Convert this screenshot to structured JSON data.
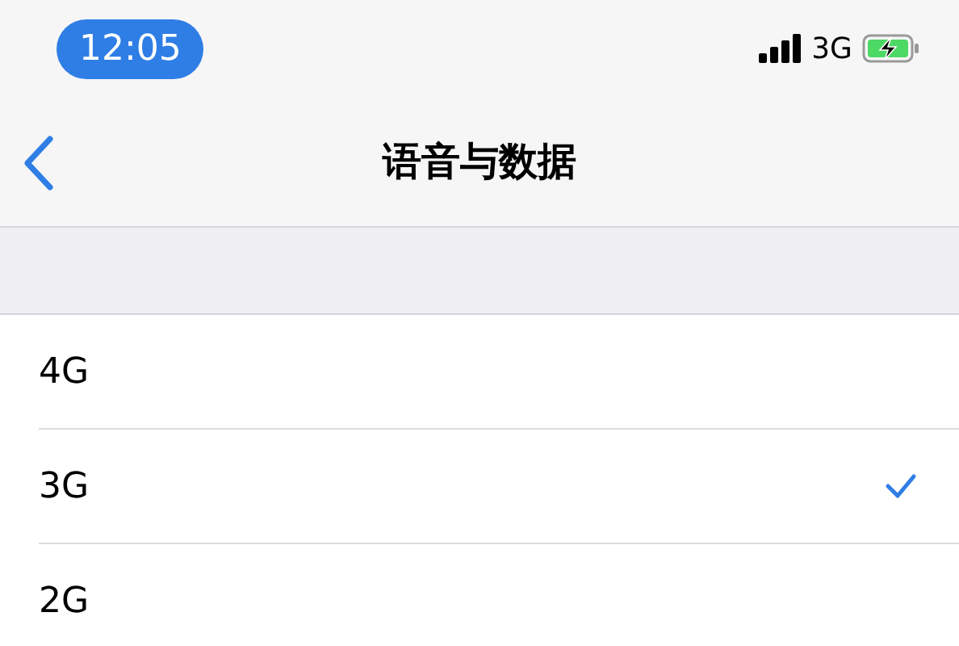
{
  "status_bar": {
    "time": "12:05",
    "network": "3G"
  },
  "nav": {
    "title": "语音与数据"
  },
  "options": [
    {
      "label": "4G",
      "selected": false
    },
    {
      "label": "3G",
      "selected": true
    },
    {
      "label": "2G",
      "selected": false
    }
  ]
}
